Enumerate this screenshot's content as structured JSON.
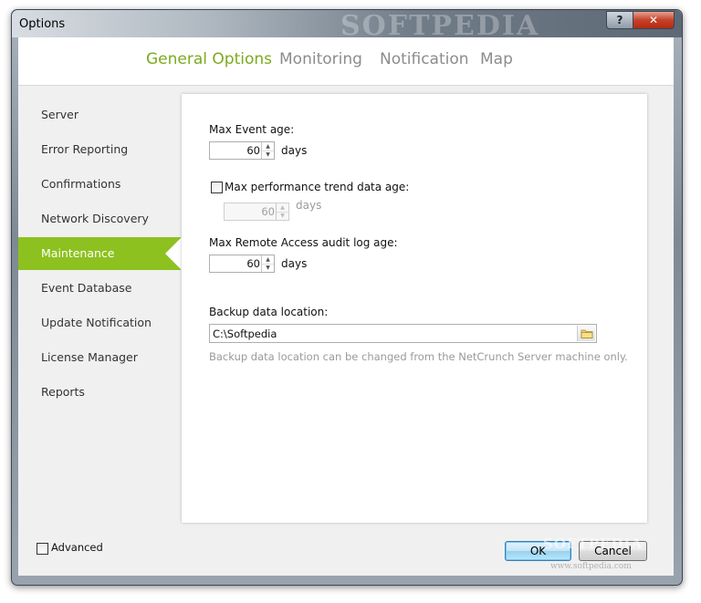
{
  "window": {
    "title": "Options",
    "watermark": "SOFTPEDIA",
    "help_glyph": "?",
    "close_glyph": "✕"
  },
  "tabs": [
    {
      "label": "General Options",
      "active": true
    },
    {
      "label": "Monitoring",
      "active": false
    },
    {
      "label": "Notification",
      "active": false
    },
    {
      "label": "Map",
      "active": false
    }
  ],
  "sidebar": {
    "items": [
      {
        "label": "Server"
      },
      {
        "label": "Error Reporting"
      },
      {
        "label": "Confirmations"
      },
      {
        "label": "Network Discovery"
      },
      {
        "label": "Maintenance",
        "active": true
      },
      {
        "label": "Event Database"
      },
      {
        "label": "Update Notification"
      },
      {
        "label": "License Manager"
      },
      {
        "label": "Reports"
      }
    ]
  },
  "panel": {
    "max_event_age": {
      "label": "Max Event age:",
      "value": "60",
      "unit": "days"
    },
    "max_perf_trend": {
      "label": "Max performance trend data age:",
      "checked": false,
      "value": "60",
      "unit": "days"
    },
    "max_remote_access": {
      "label": "Max Remote Access audit log age:",
      "value": "60",
      "unit": "days"
    },
    "backup": {
      "label": "Backup data location:",
      "value": "C:\\Softpedia",
      "hint": "Backup data location can be changed from the NetCrunch Server machine only."
    }
  },
  "footer": {
    "advanced_label": "Advanced",
    "advanced_checked": false,
    "ok_label": "OK",
    "cancel_label": "Cancel",
    "watermark_big": "SOFTPEDIA",
    "watermark_small": "www.softpedia.com"
  },
  "colors": {
    "accent": "#8dc11f",
    "active_tab": "#7caa1d",
    "inactive_tab": "#8c8c8c"
  }
}
